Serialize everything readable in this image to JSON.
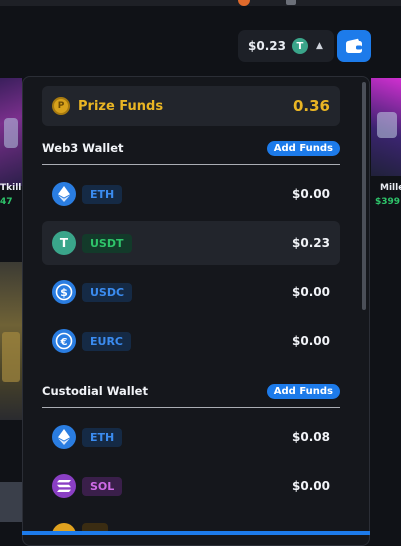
{
  "header": {
    "balance": "$0.23",
    "balance_token_icon": "tether-icon",
    "caret_icon": "caret-up-icon",
    "wallet_icon": "wallet-icon",
    "accent": "#1d7bea"
  },
  "background_cards": {
    "left_name": "Tkill",
    "left_price": "47",
    "right_name": "Mille",
    "right_price": "$399"
  },
  "prize": {
    "label": "Prize Funds",
    "value": "0.36",
    "icon": "coin-icon",
    "color": "#e9b524"
  },
  "web3": {
    "title": "Web3 Wallet",
    "add_funds": "Add Funds",
    "tokens": [
      {
        "symbol": "ETH",
        "amount": "$0.00",
        "icon": "ethereum-icon",
        "icon_color": "#2a7de1",
        "badge_bg": "#152a45",
        "badge_fg": "#3b8cf0"
      },
      {
        "symbol": "USDT",
        "amount": "$0.23",
        "icon": "tether-icon",
        "icon_color": "#3aa58a",
        "badge_bg": "#133a2a",
        "badge_fg": "#2fc46a",
        "selected": true
      },
      {
        "symbol": "USDC",
        "amount": "$0.00",
        "icon": "usdc-icon",
        "icon_color": "#2a7de1",
        "badge_bg": "#152a45",
        "badge_fg": "#3b8cf0"
      },
      {
        "symbol": "EURC",
        "amount": "$0.00",
        "icon": "eurc-icon",
        "icon_color": "#2a7de1",
        "badge_bg": "#152a45",
        "badge_fg": "#3b8cf0"
      }
    ]
  },
  "custodial": {
    "title": "Custodial Wallet",
    "add_funds": "Add Funds",
    "tokens": [
      {
        "symbol": "ETH",
        "amount": "$0.08",
        "icon": "ethereum-icon",
        "icon_color": "#2a7de1",
        "badge_bg": "#152a45",
        "badge_fg": "#3b8cf0"
      },
      {
        "symbol": "SOL",
        "amount": "$0.00",
        "icon": "solana-icon",
        "icon_color": "#8a3fc4",
        "badge_bg": "#3a1f4a",
        "badge_fg": "#d06be8"
      }
    ]
  }
}
